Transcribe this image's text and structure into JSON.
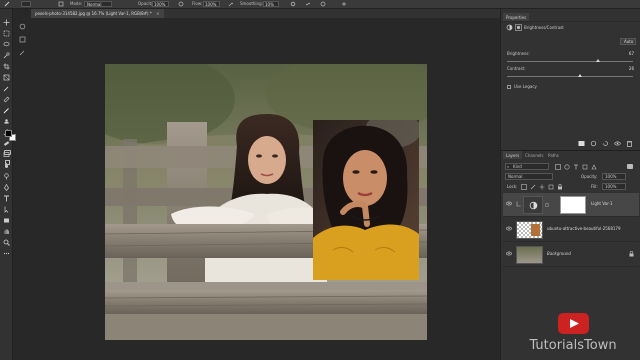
{
  "options_bar": {
    "mode_label": "Mode:",
    "mode_value": "Normal",
    "opacity_label": "Opacity:",
    "opacity_value": "100%",
    "flow_label": "Flow:",
    "flow_value": "100%",
    "smoothing_label": "Smoothing:",
    "smoothing_value": "10%"
  },
  "document": {
    "tab_title": "pexels-photo-314582.jpg @ 16.7% (Light Var-1, RGB/8#) *"
  },
  "properties": {
    "tab_label": "Properties",
    "header": "Brightness/Contrast",
    "auto_label": "Auto",
    "brightness_label": "Brightness:",
    "brightness_value": "67",
    "contrast_label": "Contrast:",
    "contrast_value": "26",
    "use_legacy_label": "Use Legacy",
    "brightness_fraction": 0.72,
    "contrast_fraction": 0.58
  },
  "layers_panel": {
    "tabs": [
      "Layers",
      "Channels",
      "Paths"
    ],
    "kind_label": "Kind",
    "blend_mode": "Normal",
    "opacity_label": "Opacity:",
    "opacity_value": "100%",
    "lock_label": "Lock:",
    "fill_label": "Fill:",
    "fill_value": "100%",
    "layers": [
      {
        "name": "Light Var-1",
        "type": "adjustment"
      },
      {
        "name": "ubuntu-attractive-beautiful-2568179",
        "type": "photo"
      },
      {
        "name": "Background",
        "type": "photo"
      }
    ]
  },
  "watermark": {
    "text": "TutorialsTown"
  },
  "colors": {
    "ui_dark": "#282828",
    "panel": "#323232",
    "selected_layer": "#474747",
    "youtube_red": "#cc2222"
  }
}
